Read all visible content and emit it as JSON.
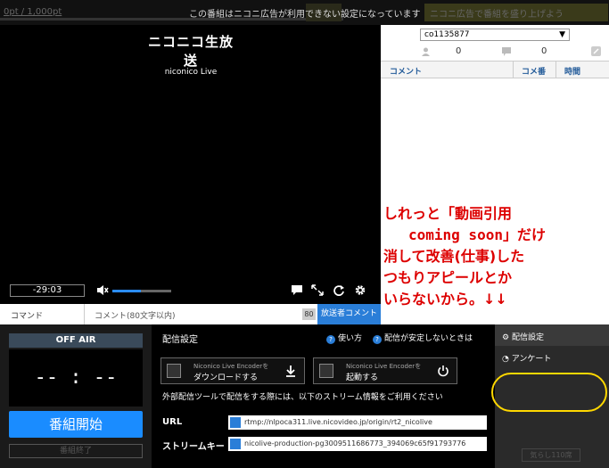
{
  "topbar": {
    "points": "0pt / 1,000pt",
    "notice": "この番組はニコニ広告が利用できない設定になっています",
    "ad_button": "ニコニ広告で番組を盛り上げよう"
  },
  "player": {
    "logo_jp": "ニコニコ生放送",
    "logo_en": "niconico Live",
    "time": "-29:03",
    "volume_level": 0.48
  },
  "comment_input": {
    "command_placeholder": "コマンド",
    "comment_placeholder": "コメント(80文字以内)",
    "char_count": "80",
    "broadcaster_button": "放送者コメント"
  },
  "right_panel": {
    "community_select": "co1135877",
    "viewer_count": "0",
    "comment_count": "0",
    "columns": [
      "コメント",
      "コメ番",
      "時間"
    ]
  },
  "overlay": {
    "line1": "しれっと「動画引用",
    "line2": "coming soon」だけ",
    "line3": "消して改善(仕事)した",
    "line4": "つもりアピールとか",
    "line5": "いらないから。↓↓"
  },
  "onair": {
    "status": "OFF AIR",
    "clock": "-- : --",
    "start_button": "番組開始",
    "end_button": "番組終了"
  },
  "settings": {
    "title": "配信設定",
    "help_howto": "使い方",
    "help_unstable": "配信が安定しないときは",
    "encoder_download_sub": "Niconico Live Encoderを",
    "encoder_download_main": "ダウンロードする",
    "encoder_launch_sub": "Niconico Live Encoderを",
    "encoder_launch_main": "起動する",
    "note": "外部配信ツールで配信をする際には、以下のストリーム情報をご利用ください",
    "url_label": "URL",
    "url_value": "rtmp://nlpoca311.live.nicovideo.jp/origin/rt2_nicolive",
    "key_label": "ストリームキー",
    "key_value": "nicolive-production-pg3009511686773_394069c65f91793776"
  },
  "sidebar": {
    "settings_item": "配信設定",
    "survey_item": "アンケート",
    "bottom_button": "気らし110席"
  },
  "colors": {
    "accent": "#1a8cff",
    "overlay_text": "#dd0000",
    "highlight_ellipse": "#ffd800"
  }
}
